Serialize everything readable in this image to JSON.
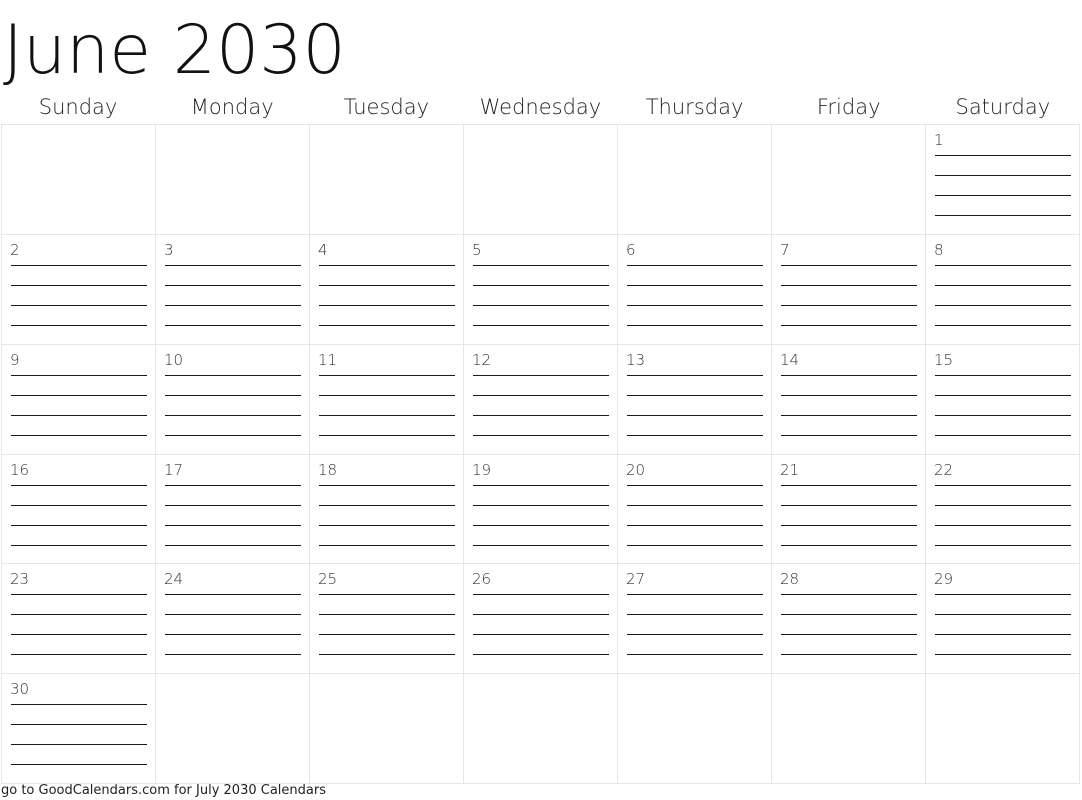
{
  "title": "June 2030",
  "weekdays": [
    "Sunday",
    "Monday",
    "Tuesday",
    "Wednesday",
    "Thursday",
    "Friday",
    "Saturday"
  ],
  "weeks": [
    [
      "",
      "",
      "",
      "",
      "",
      "",
      "1"
    ],
    [
      "2",
      "3",
      "4",
      "5",
      "6",
      "7",
      "8"
    ],
    [
      "9",
      "10",
      "11",
      "12",
      "13",
      "14",
      "15"
    ],
    [
      "16",
      "17",
      "18",
      "19",
      "20",
      "21",
      "22"
    ],
    [
      "23",
      "24",
      "25",
      "26",
      "27",
      "28",
      "29"
    ],
    [
      "30",
      "",
      "",
      "",
      "",
      "",
      ""
    ]
  ],
  "lines_per_day": 4,
  "footer": "go to GoodCalendars.com for July 2030 Calendars"
}
